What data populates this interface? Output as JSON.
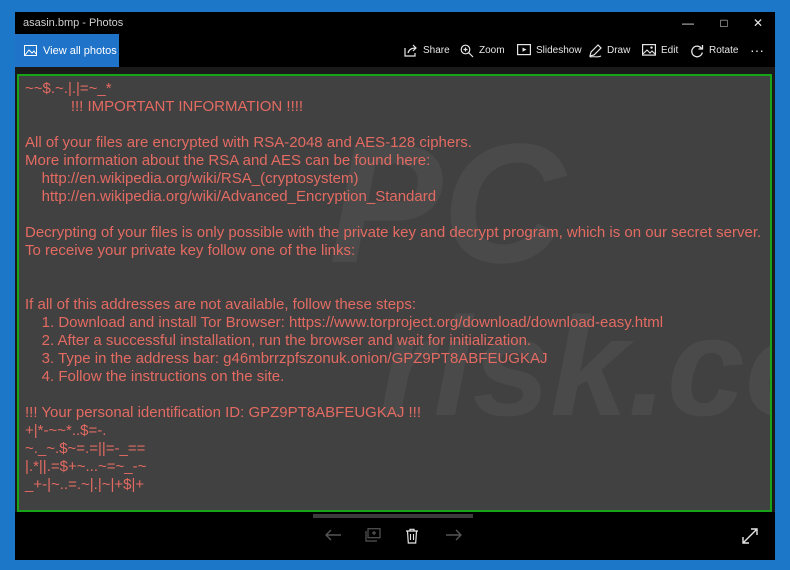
{
  "window": {
    "title": "asasin.bmp - Photos"
  },
  "toolbar": {
    "view_all": "View all photos",
    "share": "Share",
    "zoom": "Zoom",
    "slideshow": "Slideshow",
    "draw": "Draw",
    "edit": "Edit",
    "rotate": "Rotate",
    "more": "···"
  },
  "note": {
    "lines": [
      "~~$.~.|.|=~_*",
      "           !!! IMPORTANT INFORMATION !!!!",
      "",
      "All of your files are encrypted with RSA-2048 and AES-128 ciphers.",
      "More information about the RSA and AES can be found here:",
      "    http://en.wikipedia.org/wiki/RSA_(cryptosystem)",
      "    http://en.wikipedia.org/wiki/Advanced_Encryption_Standard",
      "",
      "Decrypting of your files is only possible with the private key and decrypt program, which is on our secret server.",
      "To receive your private key follow one of the links:",
      "",
      "",
      "If all of this addresses are not available, follow these steps:",
      "    1. Download and install Tor Browser: https://www.torproject.org/download/download-easy.html",
      "    2. After a successful installation, run the browser and wait for initialization.",
      "    3. Type in the address bar: g46mbrrzpfszonuk.onion/GPZ9PT8ABFEUGKAJ",
      "    4. Follow the instructions on the site.",
      "",
      "!!! Your personal identification ID: GPZ9PT8ABFEUGKAJ !!!",
      "+|*-~~*..$=-.",
      "~._~.$~=.=||=-_==",
      "|.*||.=$+~...~=~_-~",
      "_+-|~..=.~|.|~|+$|+"
    ]
  },
  "watermark": {
    "top": "PC",
    "bottom": "risk.com"
  },
  "colors": {
    "accent": "#1f73c9",
    "note_text": "#e36b62",
    "frame_border": "#18a418"
  },
  "icons": [
    "image-icon",
    "share-icon",
    "zoom-icon",
    "slideshow-icon",
    "draw-icon",
    "edit-icon",
    "rotate-icon",
    "more-icon",
    "arrow-left-icon",
    "add-to-album-icon",
    "delete-icon",
    "arrow-right-icon",
    "fullscreen-icon",
    "minimize-icon",
    "maximize-icon",
    "close-icon"
  ]
}
